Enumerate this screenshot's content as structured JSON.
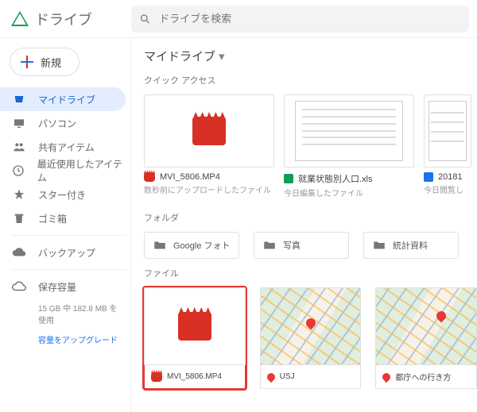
{
  "header": {
    "app_name": "ドライブ",
    "search_placeholder": "ドライブを検索"
  },
  "sidebar": {
    "new_label": "新規",
    "items": [
      {
        "label": "マイドライブ"
      },
      {
        "label": "パソコン"
      },
      {
        "label": "共有アイテム"
      },
      {
        "label": "最近使用したアイテム"
      },
      {
        "label": "スター付き"
      },
      {
        "label": "ゴミ箱"
      }
    ],
    "backup_label": "バックアップ",
    "storage_title": "保存容量",
    "storage_usage": "15 GB 中 182.8 MB を使用",
    "storage_upgrade": "容量をアップグレード"
  },
  "main": {
    "breadcrumb": "マイドライブ",
    "section_quick": "クイック アクセス",
    "section_folders": "フォルダ",
    "section_files": "ファイル",
    "quick": [
      {
        "title": "MVI_5806.MP4",
        "sub": "数秒前にアップロードしたファイル",
        "icon": "video"
      },
      {
        "title": "就業状態別人口.xls",
        "sub": "今日編集したファイル",
        "icon": "sheets"
      },
      {
        "title": "20181",
        "sub": "今日閲覧し",
        "icon": "docs"
      }
    ],
    "folders": [
      {
        "label": "Google フォト"
      },
      {
        "label": "写真"
      },
      {
        "label": "統計資料"
      }
    ],
    "files": [
      {
        "label": "MVI_5806.MP4",
        "icon": "video",
        "selected": true
      },
      {
        "label": "USJ",
        "icon": "map"
      },
      {
        "label": "都庁への行き方",
        "icon": "map"
      }
    ]
  }
}
